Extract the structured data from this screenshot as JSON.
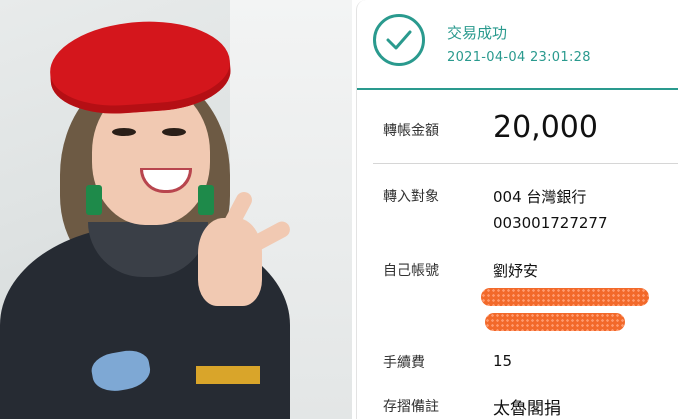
{
  "status": {
    "title": "交易成功",
    "timestamp": "2021-04-04 23:01:28",
    "icon": "check-circle-icon",
    "accent_color": "#2a9a8e"
  },
  "transfer": {
    "amount_label": "轉帳金額",
    "amount": "20,000",
    "recipient_label": "轉入對象",
    "recipient_bank": "004 台灣銀行",
    "recipient_account": "003001727277",
    "own_account_label": "自己帳號",
    "own_account_name": "劉妤安",
    "fee_label": "手續費",
    "fee": "15",
    "memo_label": "存摺備註",
    "memo": "太魯閣捐"
  },
  "redaction_color": "#f2692a"
}
